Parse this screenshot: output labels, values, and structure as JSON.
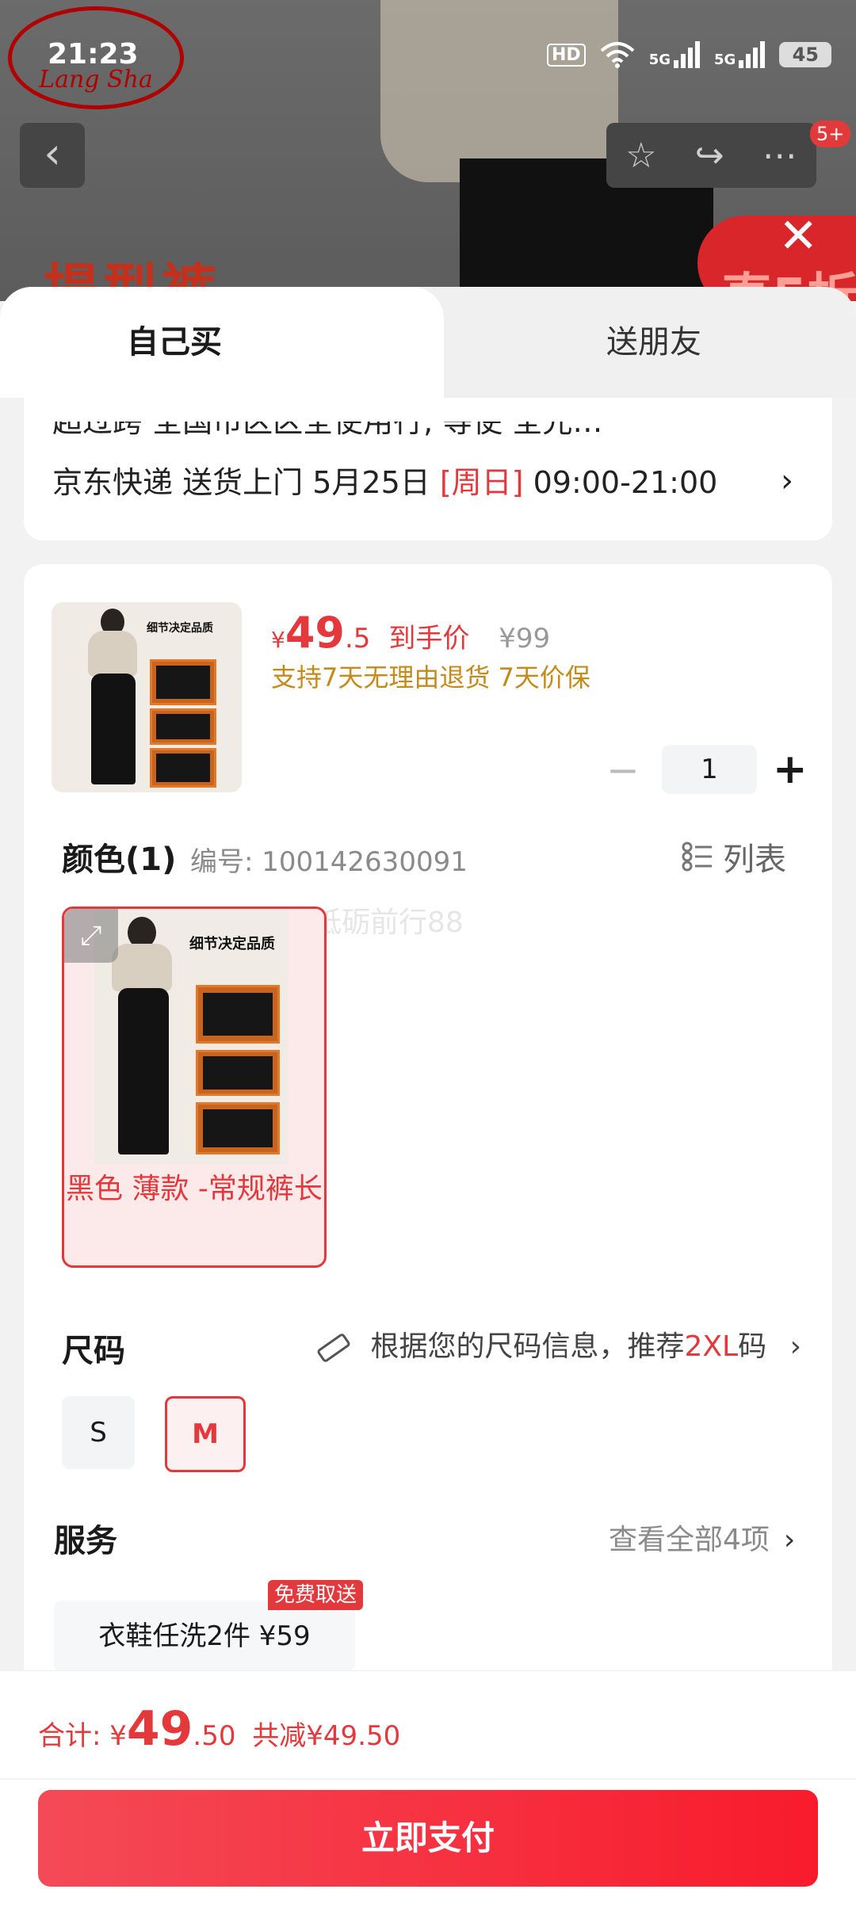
{
  "status_bar": {
    "time": "21:23",
    "hd": "HD",
    "network": "5G",
    "battery": "45"
  },
  "backdrop": {
    "brand_logo_text": "Lang Sha",
    "nav_badge": "5+"
  },
  "tabs": [
    {
      "label": "自己买",
      "active": true
    },
    {
      "label": "送朋友",
      "active": false
    }
  ],
  "delivery": {
    "cut_line": "超过跨 全国市区区全使用行, 等使 全光…",
    "carrier": "京东快递",
    "method": "送货上门",
    "date": "5月25日",
    "weekday": "[周日]",
    "time_window": "09:00-21:00"
  },
  "product": {
    "thumb_title": "细节决定品质",
    "price_symbol": "¥",
    "price_int": "49",
    "price_dec": ".5",
    "price_tag": "到手价",
    "original_price": "¥99",
    "guarantee": "支持7天无理由退货 7天价保",
    "quantity": "1",
    "minus": "−",
    "plus": "+"
  },
  "color_section": {
    "label": "颜色(1)",
    "sku": "编号: 100142630091",
    "list_label": "列表",
    "watermark": "砥砺前行88",
    "options": [
      {
        "label": "黑色 薄款 -常规裤长",
        "selected": true
      }
    ],
    "swatch_title": "细节决定品质"
  },
  "size_section": {
    "label": "尺码",
    "rec_prefix": "根据您的尺码信息，推荐",
    "rec_size": "2XL",
    "rec_suffix": "码",
    "options": [
      {
        "label": "S",
        "selected": false
      },
      {
        "label": "M",
        "selected": true
      }
    ]
  },
  "service_section": {
    "label": "服务",
    "view_all": "查看全部4项",
    "item": "衣鞋任洗2件  ¥59",
    "badge": "免费取送"
  },
  "footer": {
    "total_label": "合计: ",
    "total_symbol": "¥",
    "total_int": "49",
    "total_dec": ".50",
    "discount": "共减¥49.50",
    "pay_button": "立即支付"
  },
  "colors": {
    "accent_red": "#e4393c",
    "gold": "#c48a1a",
    "pay_button": "#f81b2c"
  }
}
